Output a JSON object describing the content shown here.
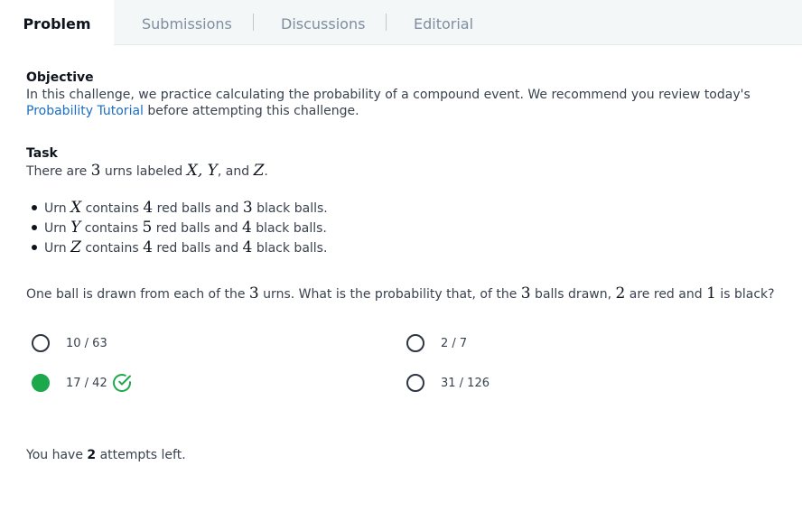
{
  "tabs": [
    {
      "label": "Problem",
      "active": true
    },
    {
      "label": "Submissions"
    },
    {
      "label": "Discussions"
    },
    {
      "label": "Editorial"
    }
  ],
  "objective": {
    "title": "Objective",
    "line1": "In this challenge, we practice calculating the probability of a compound event. We recommend you review today's",
    "link": "Probability Tutorial",
    "line2_rest": " before attempting this challenge."
  },
  "task": {
    "title": "Task",
    "intro_a": "There are ",
    "n_urns": "3",
    "intro_b": " urns labeled ",
    "labels": "X, Y",
    "intro_c": ", and ",
    "label_z": "Z",
    "intro_d": ".",
    "urns": [
      {
        "pre": "Urn ",
        "name": "X",
        "mid": " contains ",
        "red": "4",
        "mid2": " red balls and ",
        "black": "3",
        "post": " black balls."
      },
      {
        "pre": "Urn ",
        "name": "Y",
        "mid": " contains ",
        "red": "5",
        "mid2": " red balls and ",
        "black": "4",
        "post": " black balls."
      },
      {
        "pre": "Urn ",
        "name": "Z",
        "mid": " contains ",
        "red": "4",
        "mid2": " red balls and ",
        "black": "4",
        "post": " black balls."
      }
    ],
    "question": {
      "a": "One ball is drawn from each of the ",
      "n1": "3",
      "b": " urns. What is the probability that, of the ",
      "n2": "3",
      "c": " balls drawn, ",
      "n3": "2",
      "d": " are red and ",
      "n4": "1",
      "e": " is black?"
    }
  },
  "options": [
    {
      "label": "10 / 63",
      "selected": false
    },
    {
      "label": "2 / 7",
      "selected": false
    },
    {
      "label": "17 / 42",
      "selected": true,
      "correct": true
    },
    {
      "label": "31 / 126",
      "selected": false
    }
  ],
  "attempts": {
    "pre": "You have ",
    "count": "2",
    "post": " attempts left."
  },
  "colors": {
    "selected": "#1ba94c",
    "link": "#1a6fc4",
    "tab_bg": "#f3f7f7"
  }
}
